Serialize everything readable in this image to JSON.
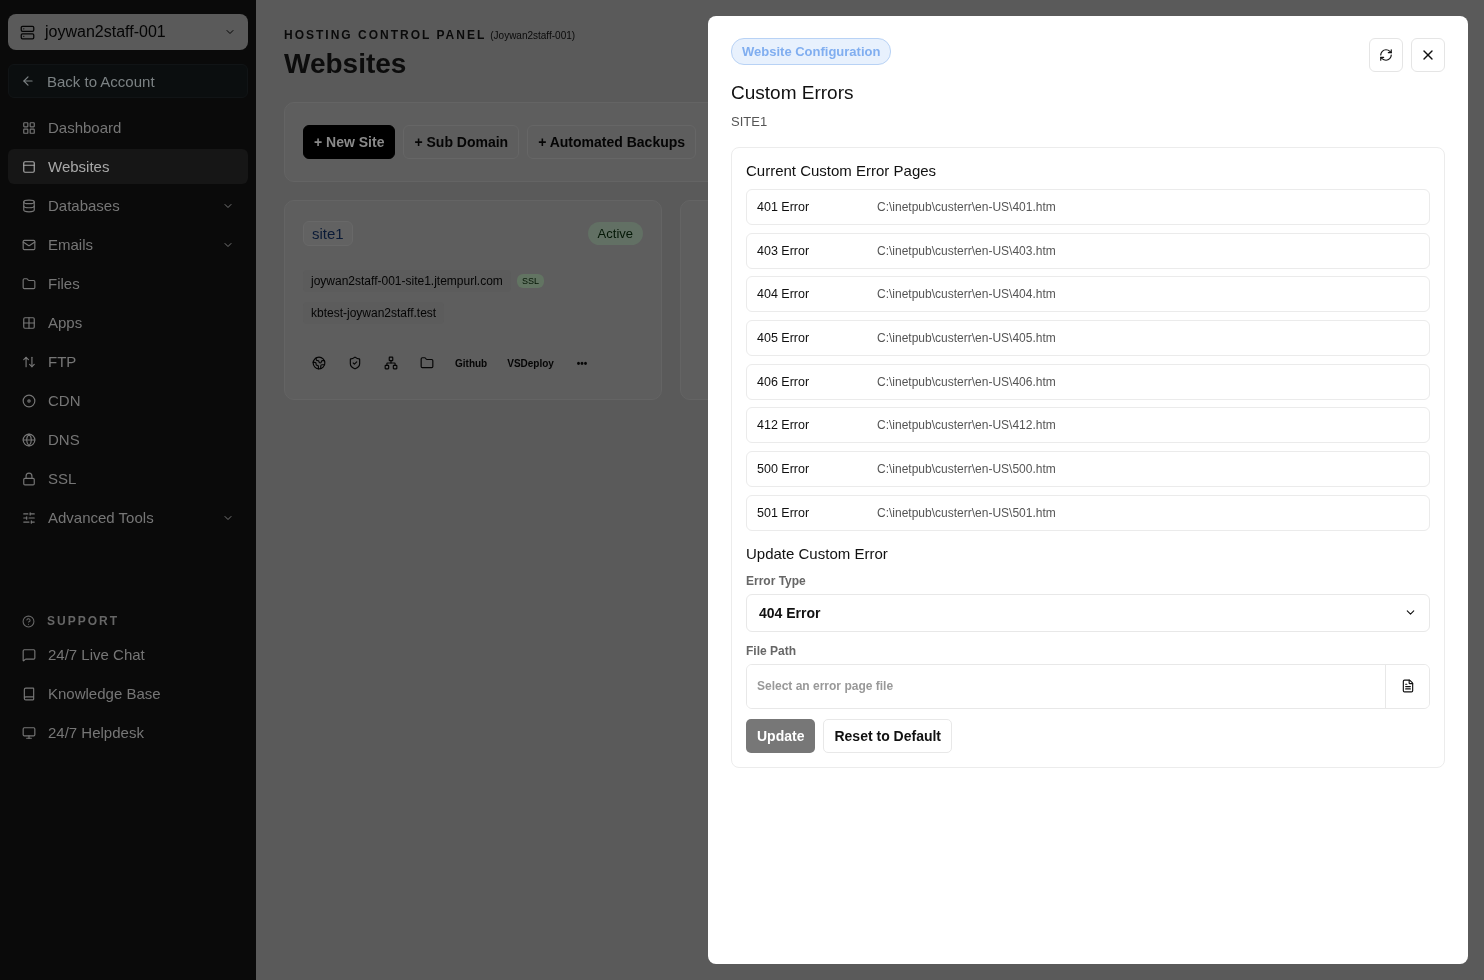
{
  "account_switcher": {
    "label": "joywan2staff-001"
  },
  "back_link": {
    "label": "Back to Account"
  },
  "sidebar": {
    "items": [
      {
        "label": "Dashboard",
        "selected": false,
        "expandable": false
      },
      {
        "label": "Websites",
        "selected": true,
        "expandable": false
      },
      {
        "label": "Databases",
        "selected": false,
        "expandable": true
      },
      {
        "label": "Emails",
        "selected": false,
        "expandable": true
      },
      {
        "label": "Files",
        "selected": false,
        "expandable": false
      },
      {
        "label": "Apps",
        "selected": false,
        "expandable": false
      },
      {
        "label": "FTP",
        "selected": false,
        "expandable": false
      },
      {
        "label": "CDN",
        "selected": false,
        "expandable": false
      },
      {
        "label": "DNS",
        "selected": false,
        "expandable": false
      },
      {
        "label": "SSL",
        "selected": false,
        "expandable": false
      },
      {
        "label": "Advanced Tools",
        "selected": false,
        "expandable": true
      }
    ],
    "support": {
      "heading": "SUPPORT",
      "items": [
        {
          "label": "24/7 Live Chat"
        },
        {
          "label": "Knowledge Base"
        },
        {
          "label": "24/7 Helpdesk"
        }
      ]
    }
  },
  "header": {
    "eyebrow": "HOSTING CONTROL PANEL",
    "account": "(Joywan2staff-001)",
    "title": "Websites"
  },
  "toolbar": {
    "buttons": [
      {
        "label": "+ New Site",
        "primary": true
      },
      {
        "label": "+ Sub Domain",
        "primary": false
      },
      {
        "label": "+ Automated Backups",
        "primary": false
      }
    ]
  },
  "sites": [
    {
      "name": "site1",
      "status": "Active",
      "domains": [
        {
          "host": "joywan2staff-001-site1.jtempurl.com",
          "ssl": "SSL"
        },
        {
          "host": "kbtest-joywan2staff.test"
        }
      ],
      "actions": [
        "Github",
        "VSDeploy"
      ],
      "more": "•••"
    }
  ],
  "dialog": {
    "badge": "Website Configuration",
    "title": "Custom Errors",
    "subtitle": "SITE1",
    "list_heading": "Current Custom Error Pages",
    "errors": [
      {
        "code": "401 Error",
        "path": "C:\\inetpub\\custerr\\en-US\\401.htm"
      },
      {
        "code": "403 Error",
        "path": "C:\\inetpub\\custerr\\en-US\\403.htm"
      },
      {
        "code": "404 Error",
        "path": "C:\\inetpub\\custerr\\en-US\\404.htm"
      },
      {
        "code": "405 Error",
        "path": "C:\\inetpub\\custerr\\en-US\\405.htm"
      },
      {
        "code": "406 Error",
        "path": "C:\\inetpub\\custerr\\en-US\\406.htm"
      },
      {
        "code": "412 Error",
        "path": "C:\\inetpub\\custerr\\en-US\\412.htm"
      },
      {
        "code": "500 Error",
        "path": "C:\\inetpub\\custerr\\en-US\\500.htm"
      },
      {
        "code": "501 Error",
        "path": "C:\\inetpub\\custerr\\en-US\\501.htm"
      }
    ],
    "form_heading": "Update Custom Error",
    "error_type": {
      "label": "Error Type",
      "value": "404 Error"
    },
    "file_path": {
      "label": "File Path",
      "placeholder": "Select an error page file"
    },
    "buttons": [
      {
        "label": "Update",
        "kind": "primary",
        "disabled": true
      },
      {
        "label": "Reset to Default",
        "kind": "secondary",
        "disabled": false
      }
    ]
  }
}
